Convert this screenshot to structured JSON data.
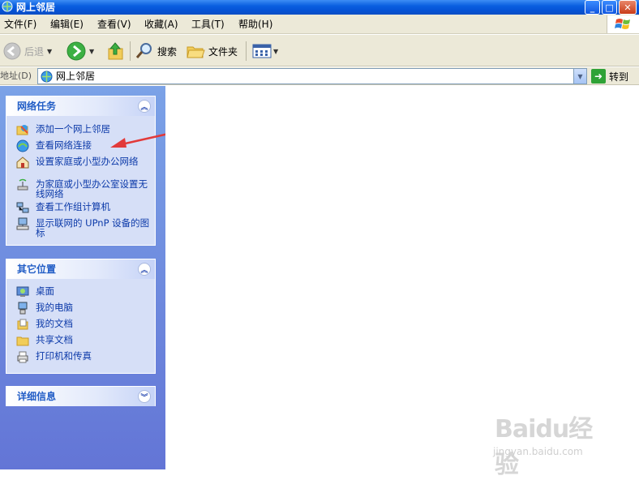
{
  "window": {
    "title": "网上邻居"
  },
  "menu": [
    "文件(F)",
    "编辑(E)",
    "查看(V)",
    "收藏(A)",
    "工具(T)",
    "帮助(H)"
  ],
  "toolbar": {
    "back": "后退",
    "search": "搜索",
    "folders": "文件夹"
  },
  "address": {
    "label": "地址(D)",
    "value": "网上邻居",
    "go": "转到"
  },
  "panels": {
    "network_tasks": {
      "title": "网络任务",
      "items": [
        {
          "label": "添加一个网上邻居",
          "icon": "add-network-place-icon"
        },
        {
          "label": "查看网络连接",
          "icon": "network-connections-icon"
        },
        {
          "label": "设置家庭或小型办公网络",
          "icon": "home-network-icon"
        },
        {
          "label": "为家庭或小型办公室设置无线网络",
          "icon": "wireless-network-icon"
        },
        {
          "label": "查看工作组计算机",
          "icon": "workgroup-computers-icon"
        },
        {
          "label": "显示联网的 UPnP 设备的图标",
          "icon": "upnp-device-icon"
        }
      ]
    },
    "other_places": {
      "title": "其它位置",
      "items": [
        {
          "label": "桌面",
          "icon": "desktop-icon"
        },
        {
          "label": "我的电脑",
          "icon": "my-computer-icon"
        },
        {
          "label": "我的文档",
          "icon": "my-documents-icon"
        },
        {
          "label": "共享文档",
          "icon": "shared-documents-icon"
        },
        {
          "label": "打印机和传真",
          "icon": "printers-icon"
        }
      ]
    },
    "details": {
      "title": "详细信息"
    }
  },
  "watermark": {
    "logo": "Baidu经验",
    "url": "jingyan.baidu.com"
  },
  "colors": {
    "title_bar": "#0553d6",
    "pane_bg": "#6f8ee0",
    "link": "#0c3aa9",
    "panel_title": "#215dc6"
  }
}
